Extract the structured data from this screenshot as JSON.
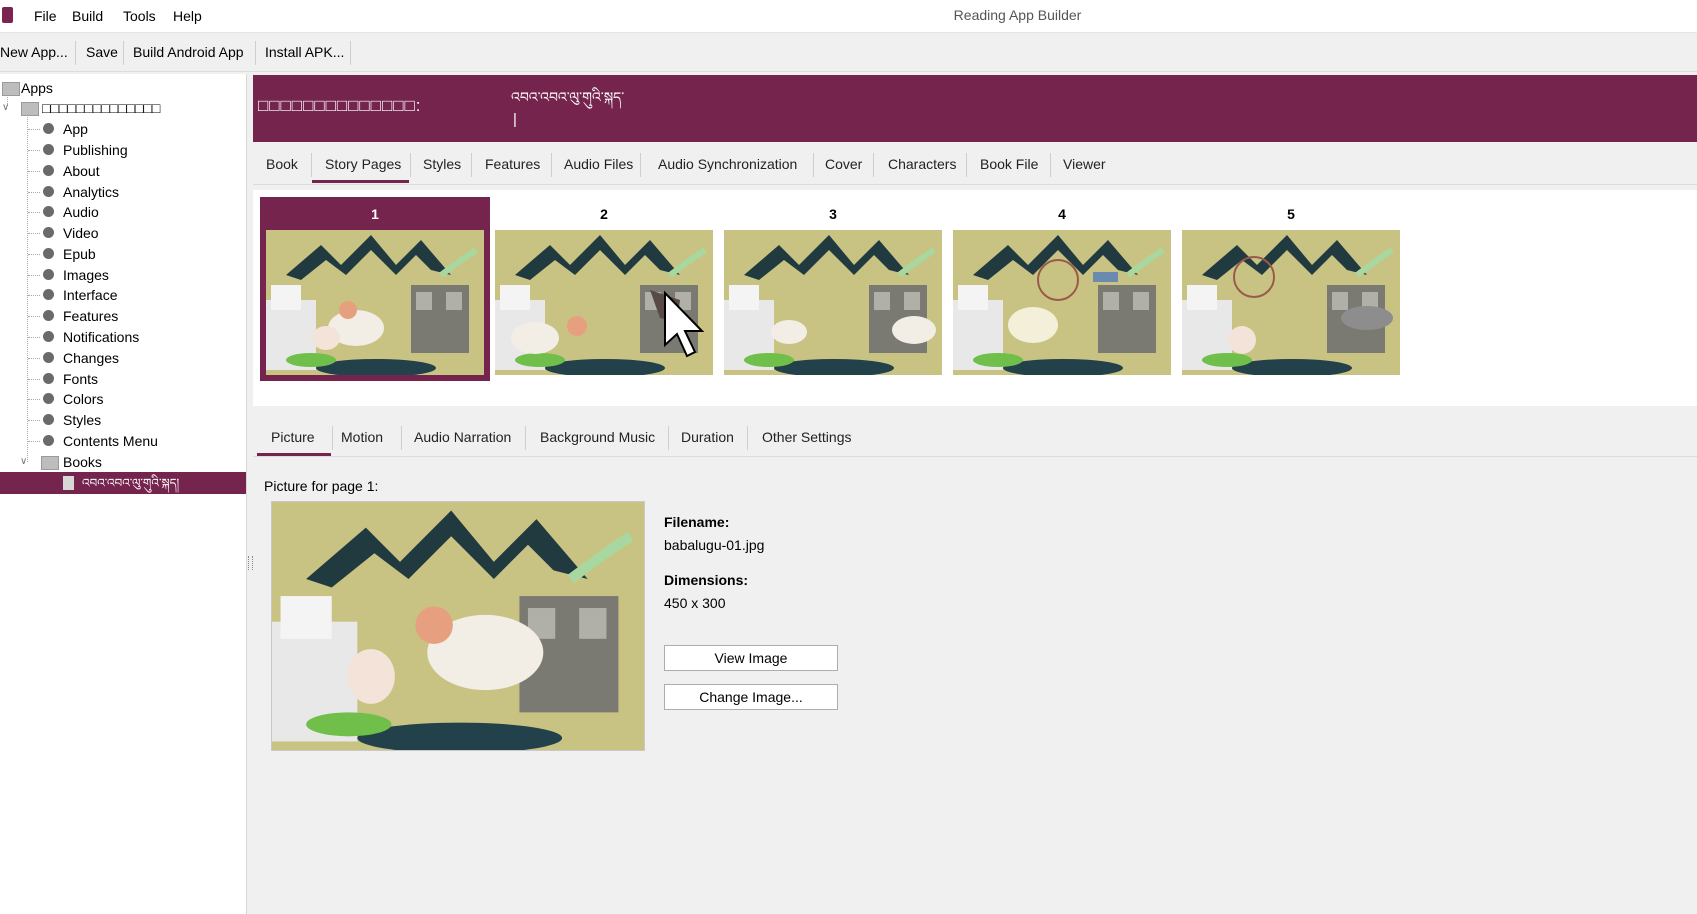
{
  "window": {
    "title": "Reading App Builder"
  },
  "menu": {
    "items": [
      "File",
      "Build",
      "Tools",
      "Help"
    ]
  },
  "toolbar": {
    "new_app": "New App...",
    "save": "Save",
    "build_android": "Build Android App",
    "install_apk": "Install APK..."
  },
  "tree": {
    "root": "Apps",
    "app_name": "□□□□□□□□□□□□□□",
    "items": [
      "App",
      "Publishing",
      "About",
      "Analytics",
      "Audio",
      "Video",
      "Epub",
      "Images",
      "Interface",
      "Features",
      "Notifications",
      "Changes",
      "Fonts",
      "Colors",
      "Styles",
      "Contents Menu"
    ],
    "books_folder": "Books",
    "selected_book": "འབའ་འབའ་ལུ་གུའི་སྐད།"
  },
  "header": {
    "book_label": "□□□□□□□□□□□□□□:",
    "book_title": "འབའ་འབའ་ལུ་གུའི་སྐད་",
    "caret": "|"
  },
  "book_tabs": {
    "items": [
      "Book",
      "Story Pages",
      "Styles",
      "Features",
      "Audio Files",
      "Audio Synchronization",
      "Cover",
      "Characters",
      "Book File",
      "Viewer"
    ],
    "active": "Story Pages"
  },
  "pages": {
    "numbers": [
      "1",
      "2",
      "3",
      "4",
      "5"
    ],
    "selected": "1"
  },
  "page_tabs": {
    "items": [
      "Picture",
      "Motion",
      "Audio Narration",
      "Background Music",
      "Duration",
      "Other Settings"
    ],
    "active": "Picture"
  },
  "picture": {
    "caption": "Picture for page 1:",
    "filename_label": "Filename:",
    "filename": "babalugu-01.jpg",
    "dimensions_label": "Dimensions:",
    "dimensions": "450 x 300",
    "view_button": "View Image",
    "change_button": "Change Image..."
  },
  "colors": {
    "accent": "#74244d",
    "scene_bg": "#c9c383",
    "mountain": "#203a40"
  }
}
